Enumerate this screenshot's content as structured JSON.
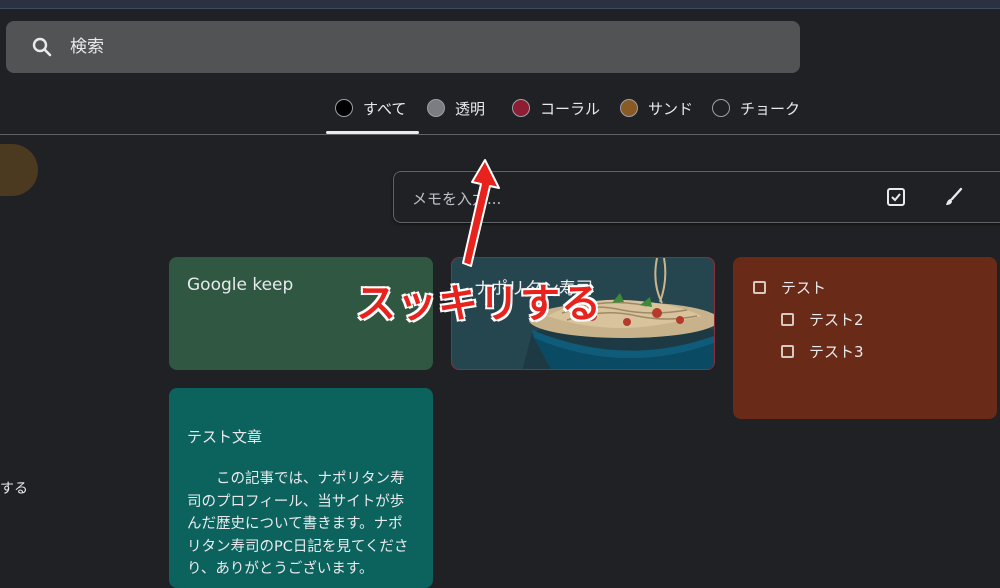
{
  "search": {
    "placeholder": "検索",
    "icon": "search-icon"
  },
  "filters": [
    {
      "label": "すべて",
      "color": "#000000"
    },
    {
      "label": "透明",
      "color": "#7b7d80"
    },
    {
      "label": "コーラル",
      "color": "#8c1d32"
    },
    {
      "label": "サンド",
      "color": "#8a5a24"
    },
    {
      "label": "チョーク",
      "color": "#202124"
    }
  ],
  "sidebar": {
    "partial_label": "する"
  },
  "take_note": {
    "placeholder": "メモを入力..."
  },
  "cards": {
    "keep": {
      "title": "Google keep",
      "color": "#2f5742"
    },
    "image_note": {
      "title": "ナポリタン寿司",
      "color": "#26464f"
    },
    "checklist": {
      "items": [
        "テスト",
        "テスト2",
        "テスト3"
      ],
      "color": "#692b17"
    },
    "text_note": {
      "title": "テスト文章",
      "body": "この記事では、ナポリタン寿司のプロフィール、当サイトが歩んだ歴史について書きます。ナポリタン寿司のPC日記を見てくださり、ありがとうございます。",
      "color": "#0c625d"
    }
  },
  "annotation": {
    "text": "スッキリする",
    "color": "#e8231d"
  }
}
